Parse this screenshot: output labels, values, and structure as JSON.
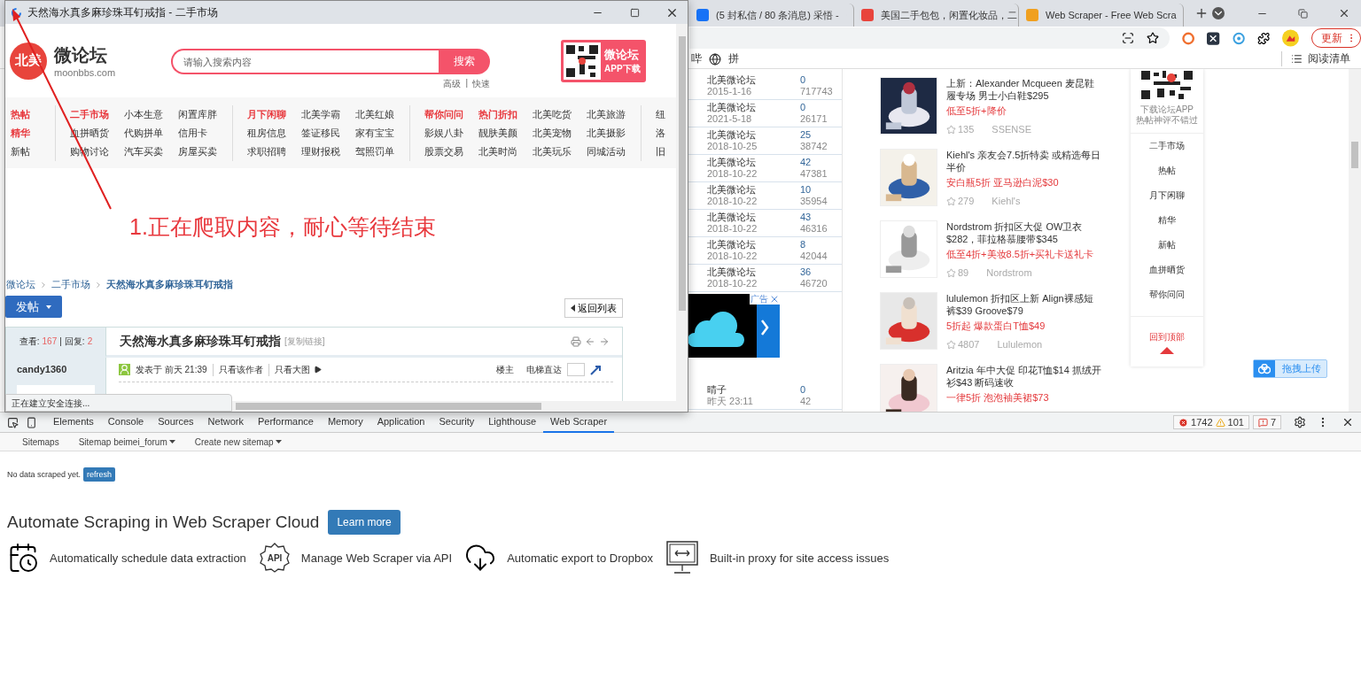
{
  "popup": {
    "title": "天然海水真多麻珍珠耳钉戒指 - 二手市场",
    "site": {
      "badge": "北美",
      "name": "微论坛",
      "domain": "moonbbs.com"
    },
    "search": {
      "placeholder": "请输入搜索内容",
      "button": "搜索",
      "links": [
        "高级",
        "快速"
      ],
      "separator": "|"
    },
    "promo": {
      "title": "微论坛",
      "subtitle": "APP下载"
    },
    "nav": [
      [
        {
          "label": "热帖",
          "hot": true
        },
        {
          "label": "精华",
          "hot": true
        },
        {
          "label": "新帖",
          "hot": false
        }
      ],
      [
        {
          "label": "二手市场",
          "hot": true
        },
        {
          "label": "血拼晒货",
          "hot": false
        },
        {
          "label": "购物讨论",
          "hot": false
        },
        {
          "label": "小本生意",
          "hot": false
        },
        {
          "label": "代购拼单",
          "hot": false
        },
        {
          "label": "汽车买卖",
          "hot": false
        },
        {
          "label": "闲置库胖",
          "hot": false
        },
        {
          "label": "信用卡",
          "hot": false
        },
        {
          "label": "房屋买卖",
          "hot": false
        }
      ],
      [
        {
          "label": "月下闲聊",
          "hot": true
        },
        {
          "label": "租房信息",
          "hot": false
        },
        {
          "label": "求职招聘",
          "hot": false
        },
        {
          "label": "北美学霸",
          "hot": false
        },
        {
          "label": "签证移民",
          "hot": false
        },
        {
          "label": "理财报税",
          "hot": false
        },
        {
          "label": "北美红娘",
          "hot": false
        },
        {
          "label": "家有宝宝",
          "hot": false
        },
        {
          "label": "驾照罚单",
          "hot": false
        }
      ],
      [
        {
          "label": "帮你问问",
          "hot": true
        },
        {
          "label": "影娱八卦",
          "hot": false
        },
        {
          "label": "股票交易",
          "hot": false
        },
        {
          "label": "热门折扣",
          "hot": true
        },
        {
          "label": "靓肤美颜",
          "hot": false
        },
        {
          "label": "北美时尚",
          "hot": false
        },
        {
          "label": "北美吃货",
          "hot": false
        },
        {
          "label": "北美宠物",
          "hot": false
        },
        {
          "label": "北美玩乐",
          "hot": false
        },
        {
          "label": "北美旅游",
          "hot": false
        },
        {
          "label": "北美摄影",
          "hot": false
        },
        {
          "label": "同城活动",
          "hot": false
        }
      ],
      [
        {
          "label": "纽",
          "hot": false
        },
        {
          "label": "洛",
          "hot": false
        },
        {
          "label": "旧",
          "hot": false
        }
      ]
    ],
    "breadcrumb": [
      "微论坛",
      "二手市场",
      "天然海水真多麻珍珠耳钉戒指"
    ],
    "post_button": "发帖",
    "back_button": "返回列表",
    "thread": {
      "views_label": "查看:",
      "views": "167",
      "replies_label": "回复:",
      "replies": "2",
      "separator": "|",
      "title": "天然海水真多麻珍珠耳钉戒指",
      "copy_link": "[复制链接]",
      "author": "candy1360",
      "posted": "发表于 前天 21:39",
      "links": [
        "只看该作者",
        "只看大图"
      ],
      "floor": "楼主",
      "jump_label": "电梯直达"
    },
    "status": "正在建立安全连接..."
  },
  "annotation": "1.正在爬取内容，耐心等待结束",
  "browser": {
    "tabs": [
      {
        "title": "(5 封私信 / 80 条消息) 采悟 -",
        "selected": false
      },
      {
        "title": "美国二手包包，闲置化妆品，二",
        "selected": false
      },
      {
        "title": "Web Scraper - Free Web Scra",
        "selected": false
      }
    ],
    "update_button": "更新",
    "bookmarks": [
      "哔",
      "拼"
    ],
    "reading_list": "阅读清单",
    "forum_rows": [
      {
        "name": "北美微论坛",
        "date": "2015-1-16",
        "replies": "0",
        "views": "717743"
      },
      {
        "name": "北美微论坛",
        "date": "2021-5-18",
        "replies": "0",
        "views": "26171"
      },
      {
        "name": "北美微论坛",
        "date": "2018-10-25",
        "replies": "25",
        "views": "38742"
      },
      {
        "name": "北美微论坛",
        "date": "2018-10-22",
        "replies": "42",
        "views": "47381"
      },
      {
        "name": "北美微论坛",
        "date": "2018-10-22",
        "replies": "10",
        "views": "35954"
      },
      {
        "name": "北美微论坛",
        "date": "2018-10-22",
        "replies": "43",
        "views": "46316"
      },
      {
        "name": "北美微论坛",
        "date": "2018-10-22",
        "replies": "8",
        "views": "42044"
      },
      {
        "name": "北美微论坛",
        "date": "2018-10-22",
        "replies": "36",
        "views": "46720"
      }
    ],
    "ad_label": "广告",
    "last_row": {
      "name": "晴子",
      "date": "昨天 23:11",
      "replies": "0",
      "views": "42"
    },
    "products": [
      {
        "title": "上新：Alexander Mcqueen 麦昆鞋履专场 男士小白鞋$295",
        "deal": "低至5折+降价",
        "stars": "135",
        "shop": "SSENSE"
      },
      {
        "title": "Kiehl's 亲友会7.5折特卖 或精选每日半价",
        "deal": "安白瓶5折 亚马逊白泥$30",
        "stars": "279",
        "shop": "Kiehl's"
      },
      {
        "title": "Nordstrom 折扣区大促 OW卫衣$282，菲拉格慕腰带$345",
        "deal": "低至4折+美妆8.5折+买礼卡送礼卡",
        "stars": "89",
        "shop": "Nordstrom"
      },
      {
        "title": "lululemon 折扣区上新 Align裸感短裤$39 Groove$79",
        "deal": "5折起 爆款蛋白T恤$49",
        "stars": "4807",
        "shop": "Lululemon"
      },
      {
        "title": "Aritzia 年中大促 印花T恤$14 抓绒开衫$43 断码速收",
        "deal": "一律5折 泡泡袖美裙$73"
      }
    ],
    "side_panel": {
      "caption": "下载论坛APP\n热帖神评不错过",
      "links": [
        "二手市场",
        "热帖",
        "月下闲聊",
        "精华",
        "新帖",
        "血拼晒货",
        "帮你问问"
      ],
      "top_link": "回到顶部"
    },
    "upload_button": "拖拽上传"
  },
  "devtools": {
    "tabs": [
      {
        "label": "Elements",
        "selected": false
      },
      {
        "label": "Console",
        "selected": false
      },
      {
        "label": "Sources",
        "selected": false
      },
      {
        "label": "Network",
        "selected": false
      },
      {
        "label": "Performance",
        "selected": false
      },
      {
        "label": "Memory",
        "selected": false
      },
      {
        "label": "Application",
        "selected": false
      },
      {
        "label": "Security",
        "selected": false
      },
      {
        "label": "Lighthouse",
        "selected": false
      },
      {
        "label": "Web Scraper",
        "selected": true
      }
    ],
    "errors": "1742",
    "warnings": "101",
    "issues": "7",
    "subtabs": [
      {
        "label": "Sitemaps",
        "dropdown": false
      },
      {
        "label": "Sitemap beimei_forum",
        "dropdown": true
      },
      {
        "label": "Create new sitemap",
        "dropdown": true
      }
    ],
    "status": "No data scraped yet.",
    "refresh": "refresh",
    "heading": "Automate Scraping in Web Scraper Cloud",
    "learn_more": "Learn more",
    "features": [
      {
        "kind": "schedule",
        "text": "Automatically schedule data extraction"
      },
      {
        "kind": "api",
        "badge": "API",
        "text": "Manage Web Scraper via API"
      },
      {
        "kind": "export",
        "text": "Automatic export to Dropbox"
      },
      {
        "kind": "proxy",
        "text": "Built-in proxy for site access issues"
      }
    ]
  }
}
